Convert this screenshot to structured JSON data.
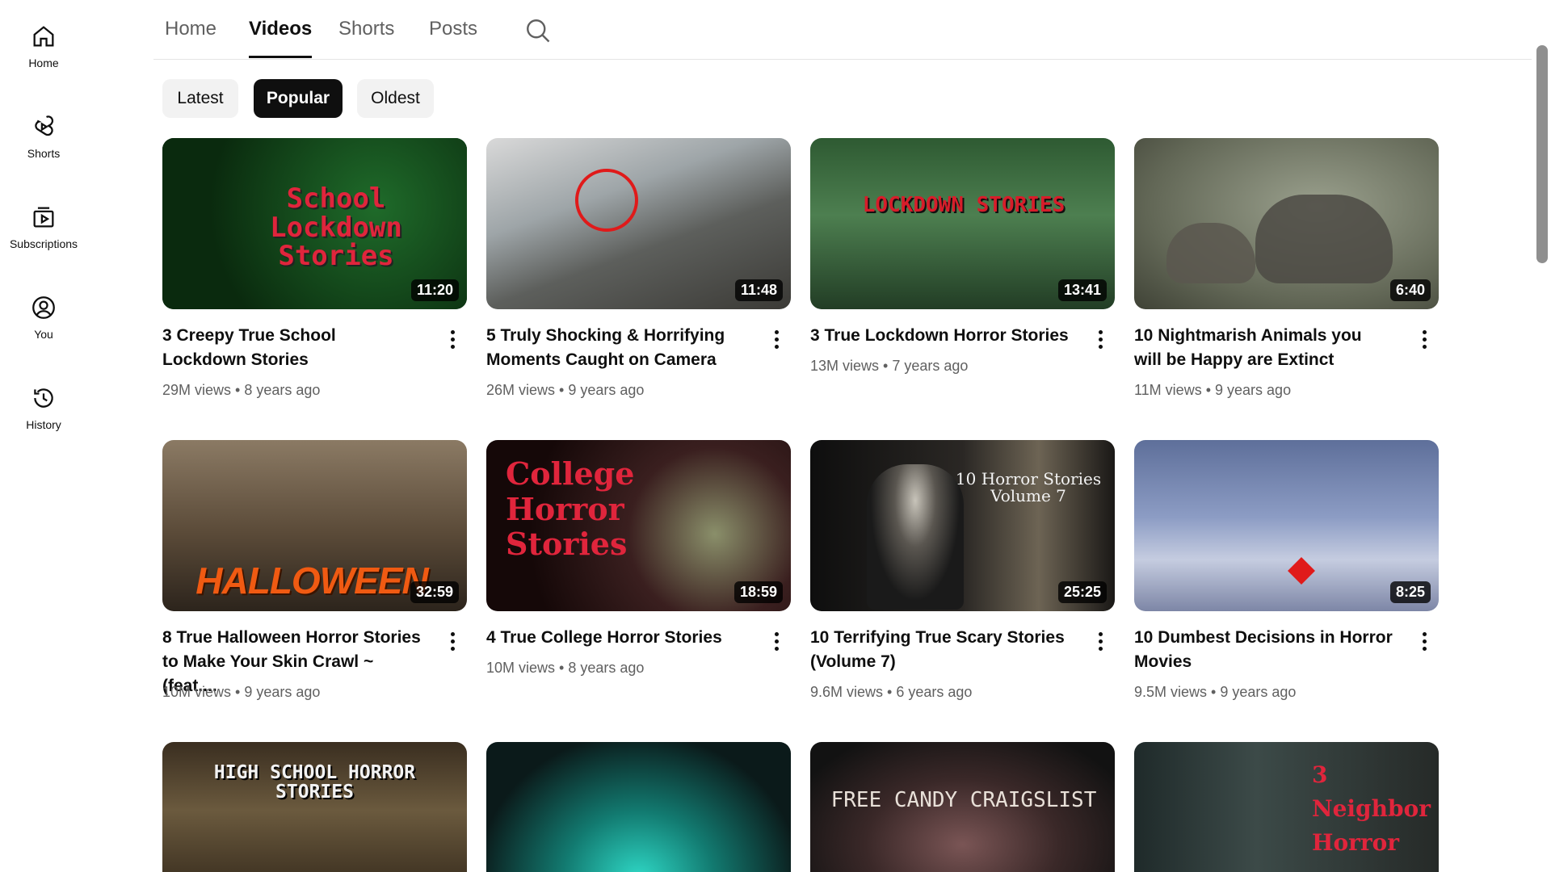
{
  "rail": {
    "items": [
      {
        "label": "Home",
        "icon": "home-icon"
      },
      {
        "label": "Shorts",
        "icon": "shorts-icon"
      },
      {
        "label": "Subscriptions",
        "icon": "subscriptions-icon"
      },
      {
        "label": "You",
        "icon": "you-icon"
      },
      {
        "label": "History",
        "icon": "history-icon"
      }
    ]
  },
  "tabs": [
    {
      "label": "Home",
      "active": false
    },
    {
      "label": "Videos",
      "active": true
    },
    {
      "label": "Shorts",
      "active": false
    },
    {
      "label": "Posts",
      "active": false
    }
  ],
  "chips": [
    {
      "label": "Latest",
      "active": false
    },
    {
      "label": "Popular",
      "active": true
    },
    {
      "label": "Oldest",
      "active": false
    }
  ],
  "videos": [
    {
      "title": "3 Creepy True School Lockdown Stories",
      "views": "29M views",
      "age": "8 years ago",
      "duration": "11:20",
      "thumb_text": "School Lockdown Stories"
    },
    {
      "title": "5 Truly Shocking & Horrifying Moments Caught on Camera",
      "views": "26M views",
      "age": "9 years ago",
      "duration": "11:48",
      "thumb_text": ""
    },
    {
      "title": "3 True Lockdown Horror Stories",
      "views": "13M views",
      "age": "7 years ago",
      "duration": "13:41",
      "thumb_text": "LOCKDOWN STORIES"
    },
    {
      "title": "10 Nightmarish Animals you will be Happy are Extinct",
      "views": "11M views",
      "age": "9 years ago",
      "duration": "6:40",
      "thumb_text": ""
    },
    {
      "title": "8 True Halloween Horror Stories to Make Your Skin Crawl ~ (feat....",
      "views": "10M views",
      "age": "9 years ago",
      "duration": "32:59",
      "thumb_text": "HALLOWEEN"
    },
    {
      "title": "4 True College Horror Stories",
      "views": "10M views",
      "age": "8 years ago",
      "duration": "18:59",
      "thumb_text": "College Horror Stories"
    },
    {
      "title": "10 Terrifying True Scary Stories (Volume 7)",
      "views": "9.6M views",
      "age": "6 years ago",
      "duration": "25:25",
      "thumb_text": "10 Horror Stories Volume 7"
    },
    {
      "title": "10 Dumbest Decisions in Horror Movies",
      "views": "9.5M views",
      "age": "9 years ago",
      "duration": "8:25",
      "thumb_text": ""
    },
    {
      "title": "",
      "views": "",
      "age": "",
      "duration": "",
      "thumb_text": "HIGH SCHOOL HORROR STORIES"
    },
    {
      "title": "",
      "views": "",
      "age": "",
      "duration": "",
      "thumb_text": ""
    },
    {
      "title": "",
      "views": "",
      "age": "",
      "duration": "",
      "thumb_text": "FREE CANDY CRAIGSLIST"
    },
    {
      "title": "",
      "views": "",
      "age": "",
      "duration": "",
      "thumb_text": "3 Neighbor Horror"
    }
  ],
  "colors": {
    "text": "#0f0f0f",
    "secondary": "#606060",
    "chip_bg": "#f2f2f2",
    "active_chip": "#0f0f0f"
  }
}
